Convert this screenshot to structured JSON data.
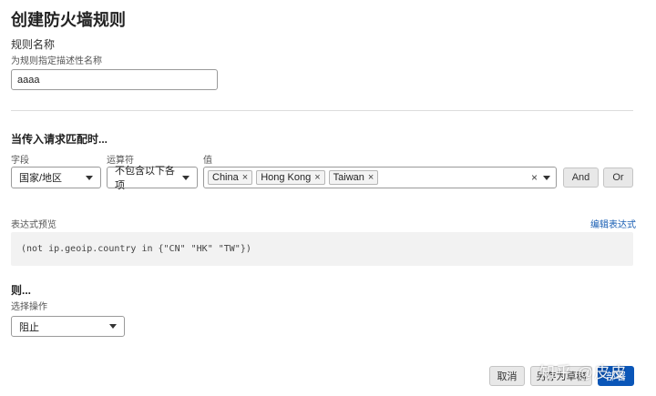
{
  "page_title": "创建防火墙规则",
  "rule_name": {
    "label": "规则名称",
    "hint": "为规则指定描述性名称",
    "value": "aaaa"
  },
  "match_section": {
    "title": "当传入请求匹配时...",
    "field_label": "字段",
    "operator_label": "运算符",
    "value_label": "值",
    "field_value": "国家/地区",
    "operator_value": "不包含以下各项",
    "chips": [
      {
        "label": "China",
        "remove": "×"
      },
      {
        "label": "Hong Kong",
        "remove": "×"
      },
      {
        "label": "Taiwan",
        "remove": "×"
      }
    ],
    "clear_symbol": "×",
    "and_label": "And",
    "or_label": "Or"
  },
  "expression": {
    "label": "表达式预览",
    "edit_link": "编辑表达式",
    "text": "(not ip.geoip.country in {\"CN\" \"HK\" \"TW\"})"
  },
  "then_section": {
    "title": "则...",
    "action_label": "选择操作",
    "action_value": "阻止"
  },
  "footer": {
    "cancel_label": "取消",
    "draft_label": "另存为草稿",
    "deploy_label": "部署"
  },
  "watermark": "知乎 @皮皮",
  "colors": {
    "primary_button": "#0a56b8",
    "link": "#1a5fb4",
    "preview_bg": "#f2f2f2"
  }
}
